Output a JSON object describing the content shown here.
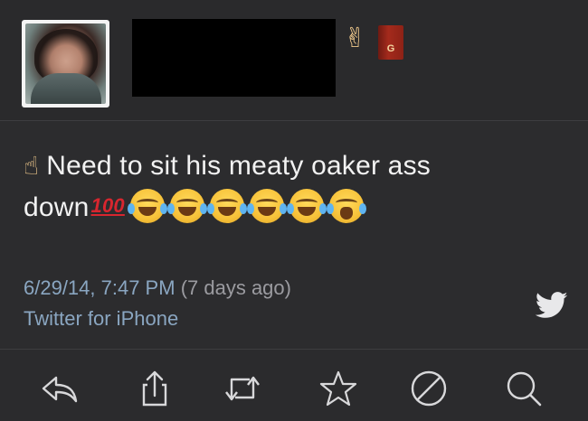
{
  "header": {
    "avatar_alt": "profile photo",
    "username": "",
    "emoji_peace": "✌",
    "emoji_book_letter": "G"
  },
  "tweet": {
    "text_line1": "Need to sit his meaty oaker ass",
    "text_line2": "down",
    "hundred_emoji": "💯",
    "finger_emoji": "☝",
    "emoji_sequence": [
      "joy",
      "joy",
      "joy",
      "joy",
      "joy",
      "sob"
    ]
  },
  "meta": {
    "timestamp": "6/29/14, 7:47 PM",
    "relative": "(7 days ago)",
    "source": "Twitter for iPhone"
  },
  "toolbar": {
    "icons": [
      "reply-icon",
      "share-icon",
      "retweet-icon",
      "favorite-icon",
      "block-icon",
      "search-icon"
    ]
  },
  "colors": {
    "background": "#2c2c2e",
    "link": "#8aa6c1",
    "text": "#f2f2f2",
    "icon": "#d8d8da"
  }
}
